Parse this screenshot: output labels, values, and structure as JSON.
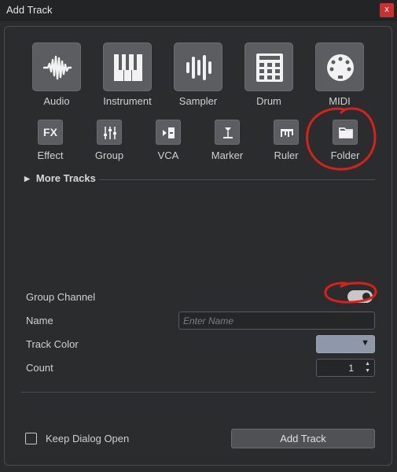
{
  "window": {
    "title": "Add Track",
    "close_label": "x"
  },
  "track_types": [
    {
      "label": "Audio",
      "icon": "waveform-icon"
    },
    {
      "label": "Instrument",
      "icon": "piano-keys-icon"
    },
    {
      "label": "Sampler",
      "icon": "sampler-bars-icon"
    },
    {
      "label": "Drum",
      "icon": "drum-pads-icon"
    },
    {
      "label": "MIDI",
      "icon": "midi-connector-icon"
    }
  ],
  "track_types_small": [
    {
      "label": "Effect",
      "icon_text": "FX"
    },
    {
      "label": "Group",
      "icon": "mixer-faders-icon"
    },
    {
      "label": "VCA",
      "icon": "vca-fader-icon"
    },
    {
      "label": "Marker",
      "icon": "marker-icon"
    },
    {
      "label": "Ruler",
      "icon": "ruler-icon"
    },
    {
      "label": "Folder",
      "icon": "folder-icon"
    }
  ],
  "more_tracks": {
    "label": "More Tracks"
  },
  "form": {
    "group_channel_label": "Group Channel",
    "group_channel_on": true,
    "name_label": "Name",
    "name_placeholder": "Enter Name",
    "name_value": "",
    "track_color_label": "Track Color",
    "track_color_value": "#8f98a8",
    "count_label": "Count",
    "count_value": "1"
  },
  "footer": {
    "keep_open_label": "Keep Dialog Open",
    "keep_open_checked": false,
    "add_track_label": "Add Track"
  }
}
